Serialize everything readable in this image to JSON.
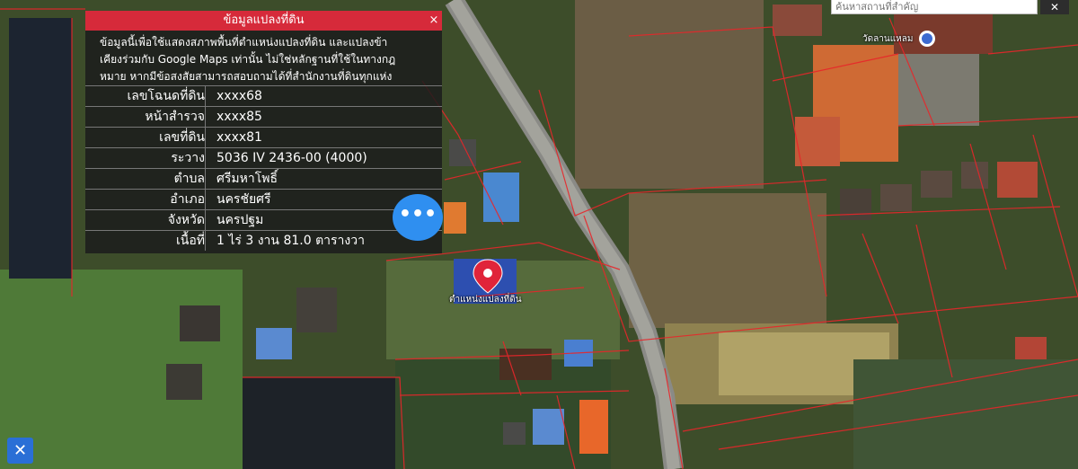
{
  "search": {
    "placeholder": "ค้นหาสถานที่สำคัญ"
  },
  "panel": {
    "title": "ข้อมูลแปลงที่ดิน",
    "close": "×",
    "description": [
      "ข้อมูลนี้เพื่อใช้แสดงสภาพพื้นที่ตำแหน่งแปลงที่ดิน และแปลงข้า",
      "เคียงร่วมกับ Google Maps เท่านั้น ไม่ใช่หลักฐานที่ใช้ในทางกฎ",
      "หมาย หากมีข้อสงสัยสามารถสอบถามได้ที่สำนักงานที่ดินทุกแห่ง"
    ],
    "rows": [
      {
        "label": "เลขโฉนดที่ดิน",
        "value": "xxxx68"
      },
      {
        "label": "หน้าสำรวจ",
        "value": "xxxx85"
      },
      {
        "label": "เลขที่ดิน",
        "value": "xxxx81"
      },
      {
        "label": "ระวาง",
        "value": "5036 IV 2436-00 (4000)"
      },
      {
        "label": "ตำบล",
        "value": "ศรีมหาโพธิ์"
      },
      {
        "label": "อำเภอ",
        "value": "นครชัยศรี"
      },
      {
        "label": "จังหวัด",
        "value": "นครปฐม"
      },
      {
        "label": "เนื้อที่",
        "value": "1 ไร่ 3 งาน 81.0 ตารางวา"
      }
    ]
  },
  "map": {
    "temple_label": "วัดลานแหลม",
    "marker_label": "ตำแหน่งแปลงที่ดิน",
    "marker_color": "#e0243a",
    "parcel_line_color": "#e8262a"
  },
  "buttons": {
    "more": "•••",
    "close_map": "✕",
    "tools": "✕"
  },
  "icons": [
    "close-icon",
    "more-icon",
    "map-pin-icon",
    "tools-icon",
    "temple-icon"
  ]
}
